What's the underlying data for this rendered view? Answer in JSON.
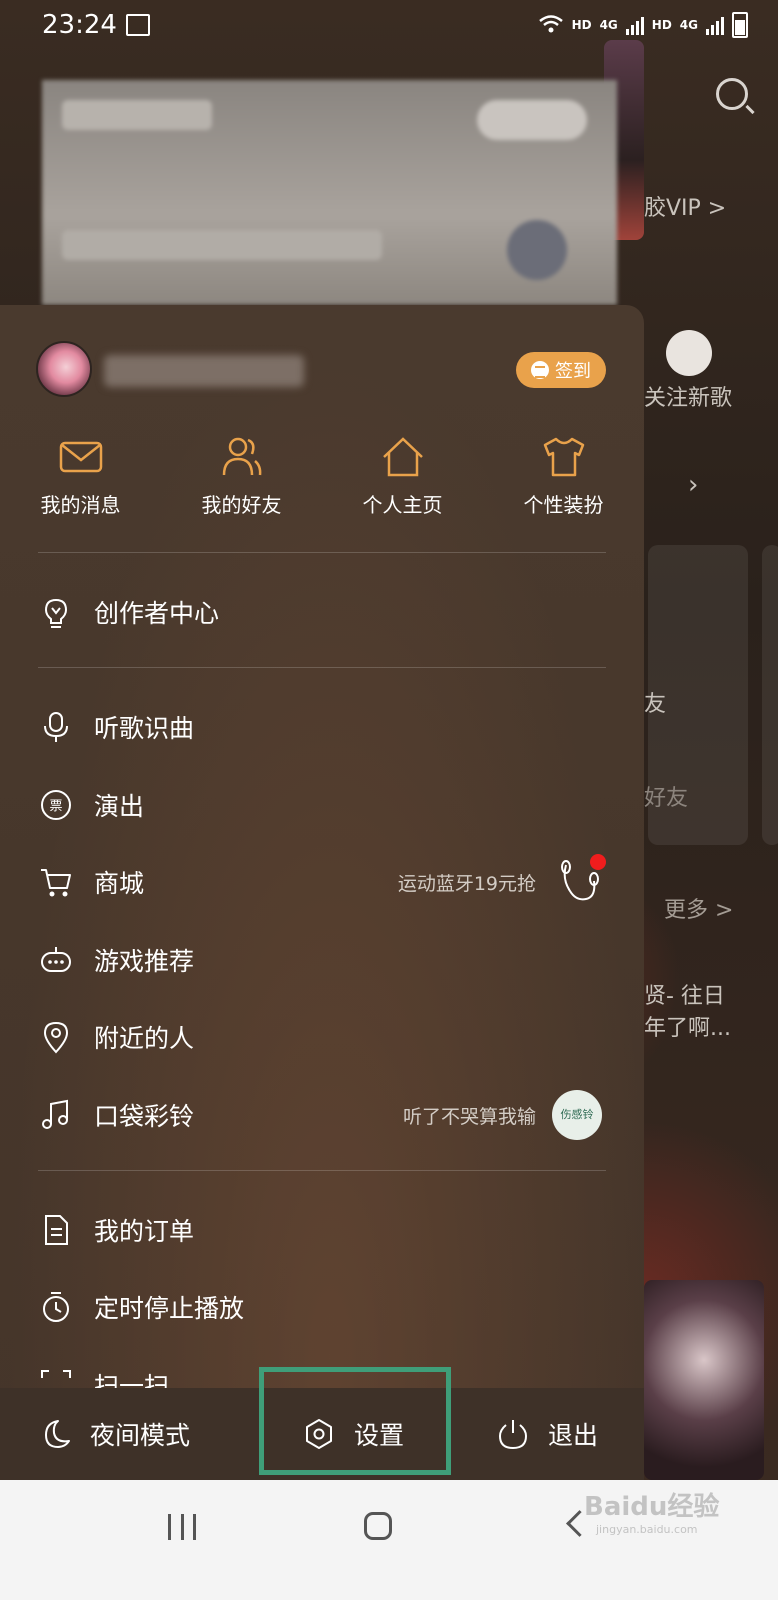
{
  "status_bar": {
    "time": "23:24",
    "network_1": "HD",
    "network_1_type": "4G",
    "network_2": "HD",
    "network_2_type": "4G"
  },
  "background": {
    "vip_text": "胶VIP >",
    "follow_text": "关注新歌",
    "friend_text": "友",
    "friend_text2": "好友",
    "more_text": "更多 >",
    "song_text1": "贤- 往日",
    "song_text2": "年了啊..."
  },
  "drawer": {
    "signin_label": "签到",
    "quick_actions": [
      {
        "label": "我的消息",
        "icon": "mail-icon"
      },
      {
        "label": "我的好友",
        "icon": "friends-icon"
      },
      {
        "label": "个人主页",
        "icon": "home-icon"
      },
      {
        "label": "个性装扮",
        "icon": "tshirt-icon"
      }
    ],
    "menu": {
      "creator_center": "创作者中心",
      "song_recognition": "听歌识曲",
      "shows": "演出",
      "store": "商城",
      "store_promo": "运动蓝牙19元抢",
      "game_recommend": "游戏推荐",
      "nearby_people": "附近的人",
      "pocket_ringtone": "口袋彩铃",
      "ringtone_promo": "听了不哭算我输",
      "ringtone_thumb_text": "伤感铃",
      "my_orders": "我的订单",
      "sleep_timer": "定时停止播放",
      "scan": "扫一扫"
    },
    "bottom": {
      "night_mode": "夜间模式",
      "settings": "设置",
      "logout": "退出"
    }
  },
  "colors": {
    "accent": "#E9A24B",
    "highlight_box": "#3F9E79",
    "notification_dot": "#F01D1D"
  },
  "watermark": {
    "brand": "Baidu经验",
    "url": "jingyan.baidu.com"
  }
}
